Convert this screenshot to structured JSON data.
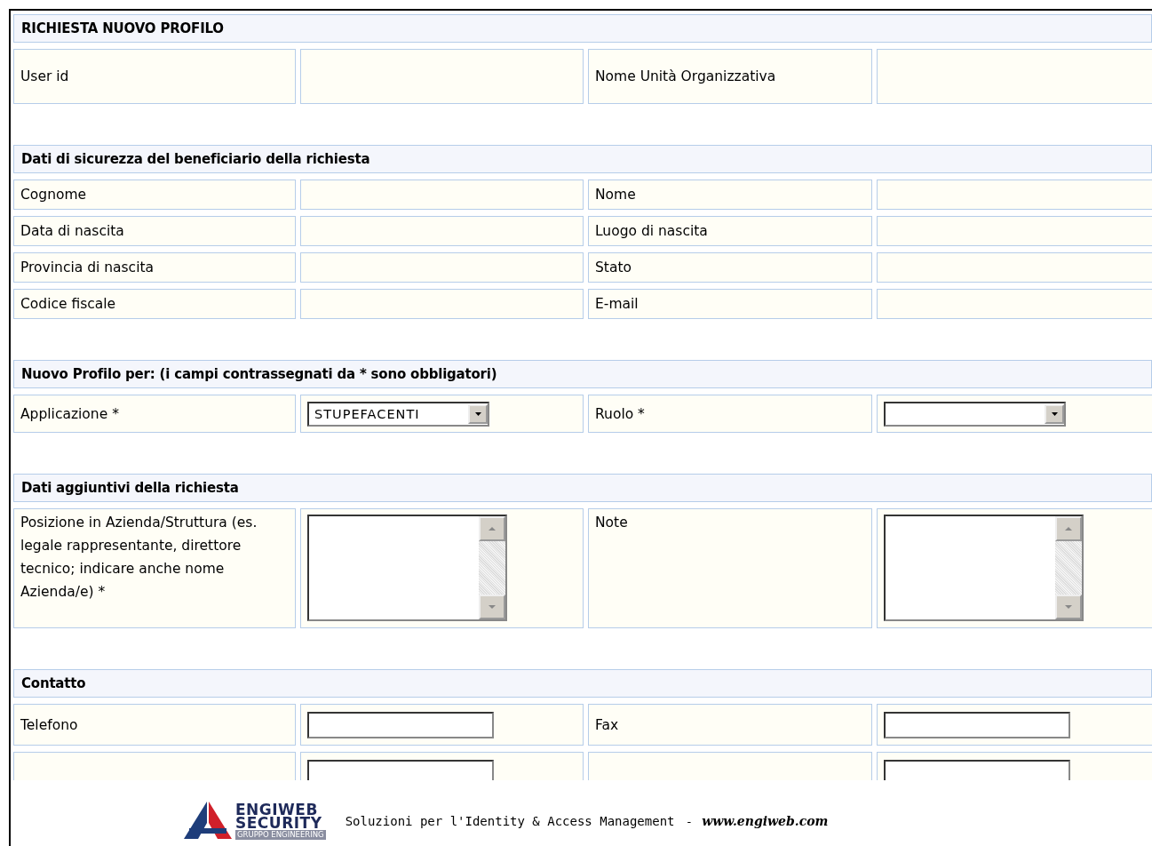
{
  "sections": [
    {
      "title": "RICHIESTA NUOVO PROFILO",
      "rows": [
        {
          "pairs": [
            {
              "label": "User id",
              "field": {
                "kind": "display"
              }
            },
            {
              "label": "Nome Unità Organizzativa",
              "field": {
                "kind": "display"
              }
            }
          ]
        }
      ]
    },
    {
      "title": "Dati di sicurezza del beneficiario della richiesta",
      "rows": [
        {
          "pairs": [
            {
              "label": "Cognome",
              "field": {
                "kind": "display"
              }
            },
            {
              "label": "Nome",
              "field": {
                "kind": "display"
              }
            }
          ]
        },
        {
          "pairs": [
            {
              "label": "Data di nascita",
              "field": {
                "kind": "display"
              }
            },
            {
              "label": "Luogo di nascita",
              "field": {
                "kind": "display"
              }
            }
          ]
        },
        {
          "pairs": [
            {
              "label": "Provincia di nascita",
              "field": {
                "kind": "display"
              }
            },
            {
              "label": "Stato",
              "field": {
                "kind": "display"
              }
            }
          ]
        },
        {
          "pairs": [
            {
              "label": "Codice fiscale",
              "field": {
                "kind": "display"
              }
            },
            {
              "label": "E-mail",
              "field": {
                "kind": "display"
              }
            }
          ]
        }
      ]
    },
    {
      "title": "Nuovo Profilo per: (i campi contrassegnati da * sono obbligatori)",
      "rows": [
        {
          "pairs": [
            {
              "label": "Applicazione *",
              "field": {
                "kind": "select",
                "value": "STUPEFACENTI"
              }
            },
            {
              "label": "Ruolo *",
              "field": {
                "kind": "select"
              }
            }
          ]
        }
      ]
    },
    {
      "title": "Dati aggiuntivi della richiesta",
      "rows": [
        {
          "pairs": [
            {
              "label": "Posizione in Azienda/Struttura (es. legale rappresentante, direttore tecnico; indicare anche nome Azienda/e) *",
              "field": {
                "kind": "textarea"
              }
            },
            {
              "label": "Note",
              "field": {
                "kind": "textarea"
              }
            }
          ]
        }
      ]
    },
    {
      "title": "Contatto",
      "rows": [
        {
          "pairs": [
            {
              "label": "Telefono",
              "field": {
                "kind": "input"
              }
            },
            {
              "label": "Fax",
              "field": {
                "kind": "input"
              }
            }
          ]
        },
        {
          "pairs": [
            {
              "field": {
                "kind": "input"
              }
            },
            {
              "field": {
                "kind": "input"
              }
            }
          ]
        }
      ]
    }
  ],
  "footer": {
    "logo_name": "ENGIWEB",
    "logo_sub": "SECURITY",
    "logo_group": "GRUPPO ENGINEERING",
    "tagline": "Soluzioni per l'Identity & Access Management",
    "separator": "-",
    "url": "www.engiweb.com"
  }
}
